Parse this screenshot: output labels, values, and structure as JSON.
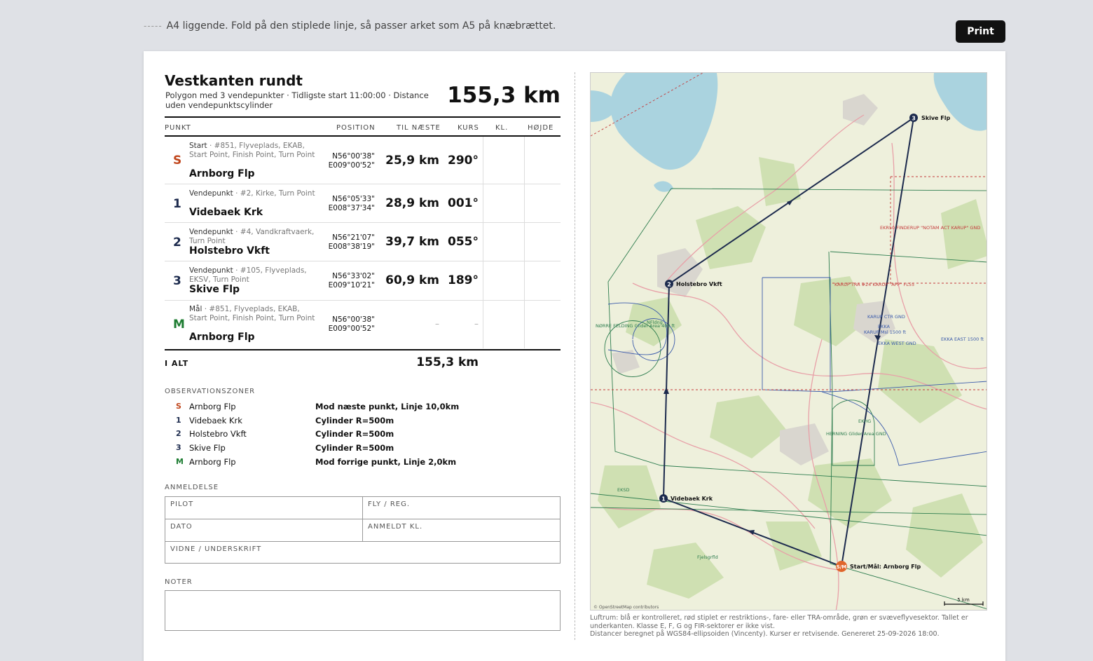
{
  "top": {
    "fold_note": "A4 liggende. Fold på den stiplede linje, så passer arket som A5 på knæbrættet.",
    "fold_marker": "-----",
    "print_label": "Print"
  },
  "task": {
    "title": "Vestkanten rundt",
    "subtitle": "Polygon med 3 vendepunkter · Tidligste start 11:00:00 · Distance uden vendepunktscylinder",
    "total_distance": "155,3 km"
  },
  "table": {
    "headers": {
      "point": "PUNKT",
      "position": "POSITION",
      "to_next": "TIL NÆSTE",
      "course": "KURS",
      "time": "KL.",
      "height": "HØJDE"
    },
    "rows": [
      {
        "sym": "S",
        "meta_type": "Start",
        "meta_rest": " · #851, Flyveplads, EKAB, Start Point, Finish Point, Turn Point",
        "name": "Arnborg Flp",
        "lat": "N56°00'38\"",
        "lon": "E009°00'52\"",
        "dist": "25,9 km",
        "course": "290°"
      },
      {
        "sym": "1",
        "meta_type": "Vendepunkt",
        "meta_rest": " · #2, Kirke, Turn Point",
        "name": "Videbaek Krk",
        "lat": "N56°05'33\"",
        "lon": "E008°37'34\"",
        "dist": "28,9 km",
        "course": "001°"
      },
      {
        "sym": "2",
        "meta_type": "Vendepunkt",
        "meta_rest": " · #4, Vandkraftvaerk, Turn Point",
        "name": "Holstebro Vkft",
        "lat": "N56°21'07\"",
        "lon": "E008°38'19\"",
        "dist": "39,7 km",
        "course": "055°"
      },
      {
        "sym": "3",
        "meta_type": "Vendepunkt",
        "meta_rest": " · #105, Flyveplads, EKSV, Turn Point",
        "name": "Skive Flp",
        "lat": "N56°33'02\"",
        "lon": "E009°10'21\"",
        "dist": "60,9 km",
        "course": "189°"
      },
      {
        "sym": "M",
        "meta_type": "Mål",
        "meta_rest": " · #851, Flyveplads, EKAB, Start Point, Finish Point, Turn Point",
        "name": "Arnborg Flp",
        "lat": "N56°00'38\"",
        "lon": "E009°00'52\"",
        "dist": "–",
        "course": "–"
      }
    ],
    "total_label": "I ALT",
    "total_value": "155,3 km"
  },
  "observation_zones": {
    "heading": "OBSERVATIONSZONER",
    "items": [
      {
        "sym": "S",
        "name": "Arnborg Flp",
        "zone": "Mod næste punkt, Linje 10,0km"
      },
      {
        "sym": "1",
        "name": "Videbaek Krk",
        "zone": "Cylinder R=500m"
      },
      {
        "sym": "2",
        "name": "Holstebro Vkft",
        "zone": "Cylinder R=500m"
      },
      {
        "sym": "3",
        "name": "Skive Flp",
        "zone": "Cylinder R=500m"
      },
      {
        "sym": "M",
        "name": "Arnborg Flp",
        "zone": "Mod forrige punkt, Linje 2,0km"
      }
    ]
  },
  "registration": {
    "heading": "ANMELDELSE",
    "pilot": "PILOT",
    "aircraft": "FLY / REG.",
    "date": "DATO",
    "reported_time": "ANMELDT KL.",
    "witness": "VIDNE / UNDERSKRIFT"
  },
  "notes": {
    "heading": "NOTER"
  },
  "map": {
    "labels": {
      "skive": "Skive Flp",
      "holstebro": "Holstebro Vkft",
      "videbaek": "Videbaek Krk",
      "start": "Start/Mål: Arnborg Flp",
      "start_marker": "S/M",
      "wp1": "1",
      "wp2": "2",
      "wp3": "3",
      "finderup": "EKR50 FINDERUP \"NOTAM ACT KARUP\" GND",
      "karup_tra": "KARUP TRA #24 KARUP \"APP\" FL55",
      "karup_ctr": "KARUP CTR GND",
      "karup_msl": "KARUP Msl 1500 ft",
      "ekka_west": "EKKA WEST GND",
      "ekka_east": "EKKA EAST 1500 ft",
      "ekka": "EKKA",
      "nfeld": "NFldng",
      "nfeld_area": "NØRRE FELDING Glider Area 400 ft",
      "herning_area": "HERNING Glider Area GND",
      "ekhg": "EKHG",
      "eksd": "EKSD",
      "fjelstrup": "Fjelsgrfld",
      "osm": "© OpenStreetMap contributors",
      "scale": "5 km"
    },
    "caption_1": "Luftrum: blå er kontrolleret, rød stiplet er restriktions-, fare- eller TRA-område, grøn er svæveflyvesektor. Tallet er underkanten. Klasse E, F, G og FIR-sektorer er ikke vist.",
    "caption_2": "Distancer beregnet på WGS84-ellipsoiden (Vincenty). Kurser er retvisende. Genereret 25-09-2026 18:00.",
    "colors": {
      "land": "#eef0dc",
      "forest": "#cfe0b2",
      "water": "#aad3df",
      "route": "#1c2a4d",
      "controlled": "#3b5bab",
      "restricted": "#c43a3a",
      "glider": "#2e7d4f",
      "start": "#e0662b"
    }
  }
}
